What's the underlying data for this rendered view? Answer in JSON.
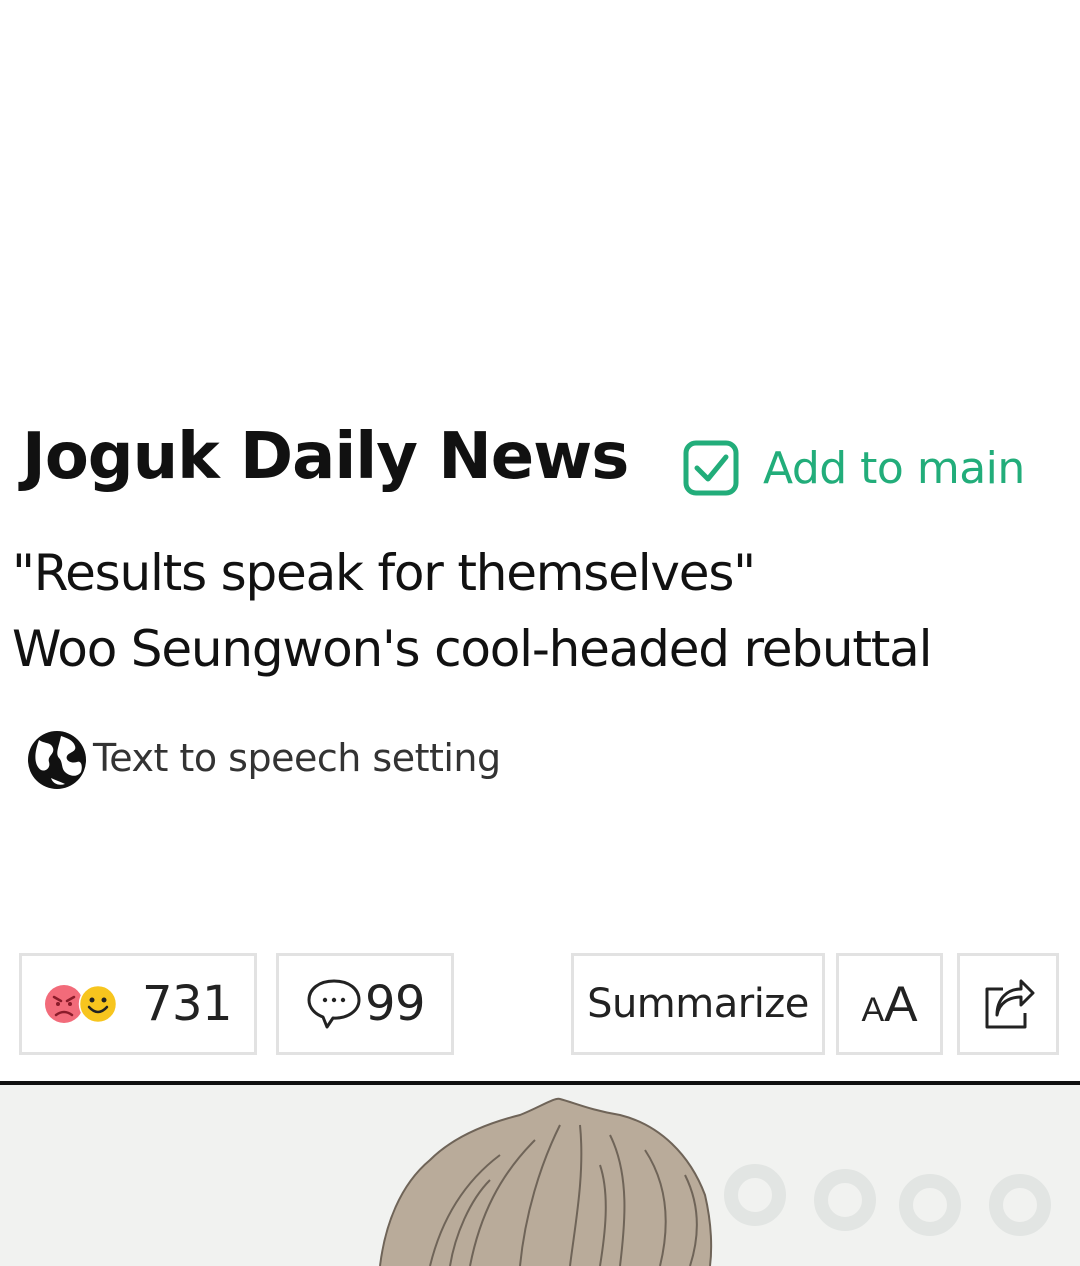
{
  "article": {
    "publisher": "Joguk Daily News",
    "add_to_main_label": "Add to main",
    "headline_line1": "\"Results speak for themselves\"",
    "headline_line2": "Woo Seungwon's cool-headed rebuttal",
    "tts_label": "Text to speech setting"
  },
  "toolbar": {
    "reaction_count": "731",
    "comment_count": "99",
    "summarize_label": "Summarize",
    "font_small": "A",
    "font_big": "A"
  },
  "icons": {
    "add_to_main": "checkbox-checked-icon",
    "tts": "globe-icon",
    "reactions": [
      "angry-face-icon",
      "smiley-face-icon"
    ],
    "comments": "speech-bubble-icon",
    "font_size": "font-size-icon",
    "share": "share-icon"
  },
  "colors": {
    "accent_green": "#22ad7a",
    "text_primary": "#111111",
    "button_border": "#e2e2e2",
    "angry_face": "#f26b7a",
    "smiley_face": "#f7c51e"
  }
}
